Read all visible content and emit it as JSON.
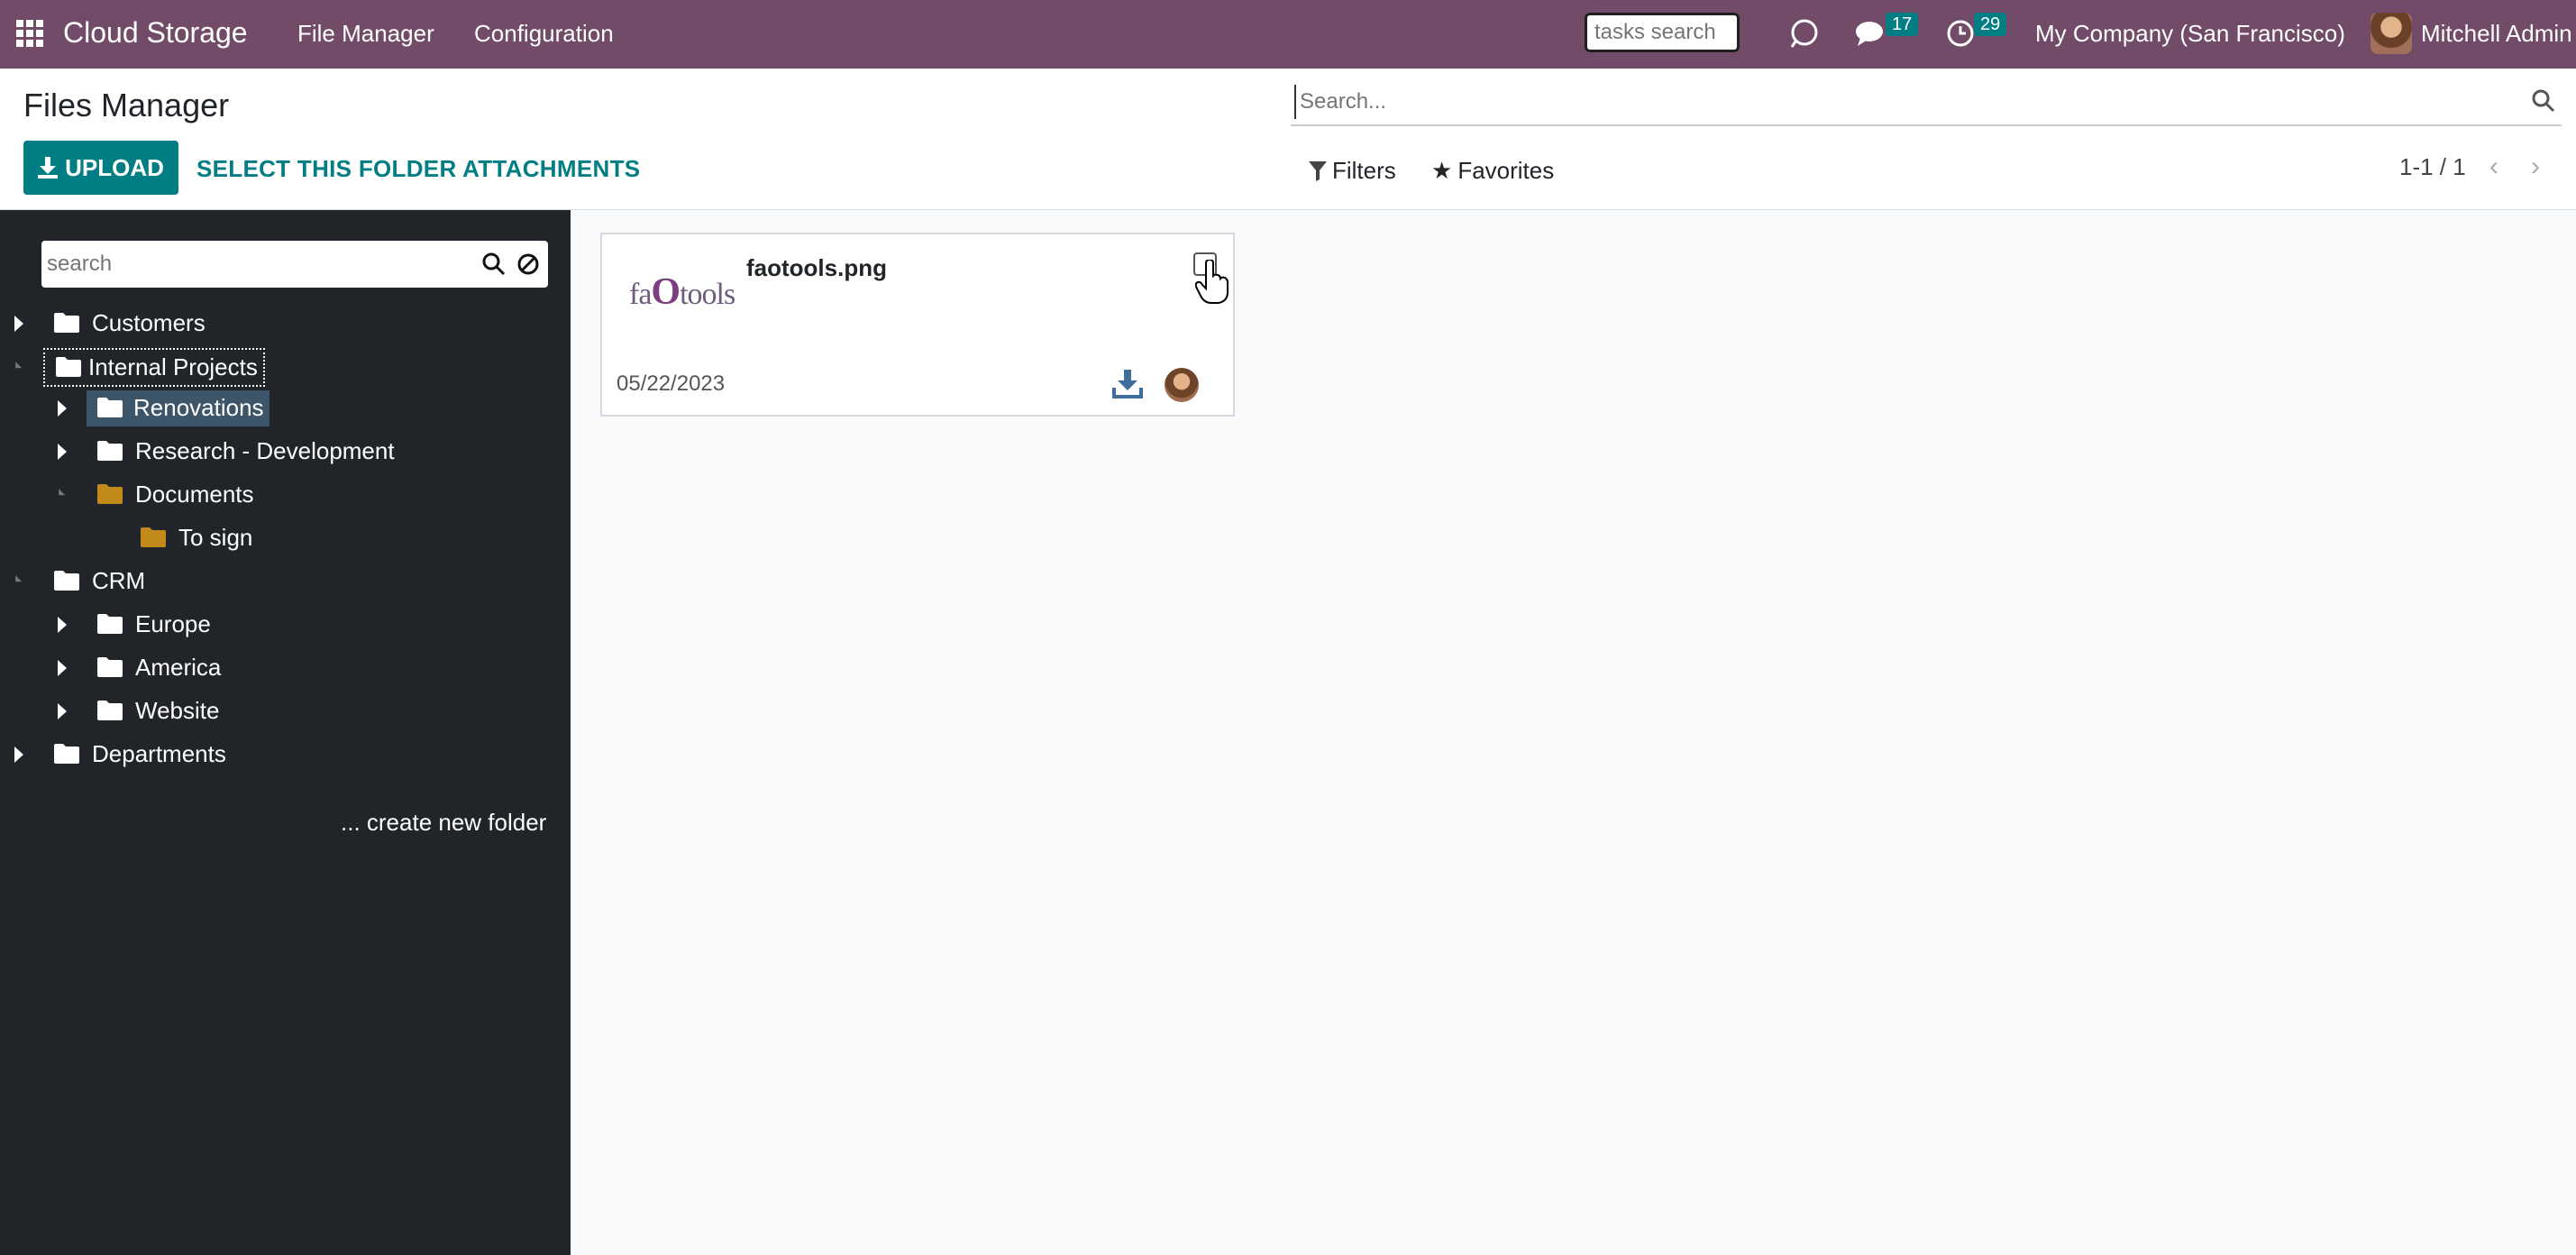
{
  "navbar": {
    "brand": "Cloud Storage",
    "menu": [
      "File Manager",
      "Configuration"
    ],
    "tasks_search_placeholder": "tasks search",
    "messages_count": "17",
    "activities_count": "29",
    "company": "My Company (San Francisco)",
    "user": "Mitchell Admin",
    "icons": [
      "apps-grid-icon",
      "bug-icon",
      "chat-icon",
      "clock-icon"
    ]
  },
  "control_panel": {
    "title": "Files Manager",
    "upload_label": "UPLOAD",
    "select_attachments_label": "SELECT THIS FOLDER ATTACHMENTS",
    "search_placeholder": "Search...",
    "filters_label": "Filters",
    "favorites_label": "Favorites",
    "pager": "1-1 / 1"
  },
  "sidebar": {
    "search_placeholder": "search",
    "folders": [
      {
        "label": "Customers",
        "state": "collapsed"
      },
      {
        "label": "Internal Projects",
        "state": "expanded",
        "focused": true
      },
      {
        "label": "Renovations",
        "state": "collapsed",
        "selected": true
      },
      {
        "label": "Research - Development",
        "state": "collapsed"
      },
      {
        "label": "Documents",
        "state": "expanded",
        "color": "#c28a1a"
      },
      {
        "label": "To sign",
        "state": "leaf",
        "color": "#c28a1a"
      },
      {
        "label": "CRM",
        "state": "expanded"
      },
      {
        "label": "Europe",
        "state": "collapsed"
      },
      {
        "label": "America",
        "state": "collapsed"
      },
      {
        "label": "Website",
        "state": "collapsed"
      },
      {
        "label": "Departments",
        "state": "collapsed"
      }
    ],
    "create_folder_label": "... create new folder"
  },
  "files": [
    {
      "name": "faotools.png",
      "date": "05/22/2023",
      "thumbnail_text_pre": "fa",
      "thumbnail_text_mid": "O",
      "thumbnail_text_post": "tools"
    }
  ],
  "colors": {
    "navbar": "#714b67",
    "accent": "#017e84",
    "sidebar": "#212529",
    "selected_folder": "#3d5568",
    "special_folder": "#c28a1a"
  }
}
